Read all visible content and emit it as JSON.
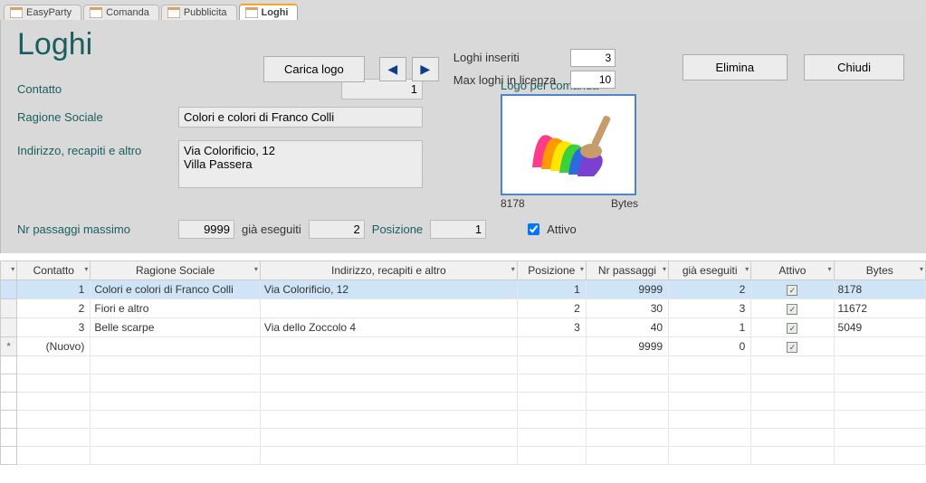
{
  "tabs": [
    {
      "label": "EasyParty"
    },
    {
      "label": "Comanda"
    },
    {
      "label": "Pubblicita"
    },
    {
      "label": "Loghi"
    }
  ],
  "title": "Loghi",
  "btn_load": "Carica logo",
  "btn_delete": "Elimina",
  "btn_close": "Chiudi",
  "lbl_inserted": "Loghi inseriti",
  "lbl_maxlic": "Max loghi in licenza",
  "val_inserted": "3",
  "val_maxlic": "10",
  "lbl_contatto": "Contatto",
  "lbl_ragione": "Ragione Sociale",
  "lbl_indirizzo": "Indirizzo, recapiti e altro",
  "lbl_nrpass": "Nr passaggi massimo",
  "lbl_giaeseg": "già eseguiti",
  "lbl_posizione": "Posizione",
  "lbl_attivo": "Attivo",
  "lbl_logoper": "Logo per comanda",
  "val_contatto": "1",
  "val_ragione": "Colori e colori di Franco Colli",
  "val_indirizzo": "Via Colorificio, 12\nVilla Passera",
  "val_nrpass": "9999",
  "val_giaeseg": "2",
  "val_posizione": "1",
  "val_attivo": true,
  "logo_size": "8178",
  "logo_bytes_lbl": "Bytes",
  "cols": {
    "contatto": "Contatto",
    "ragione": "Ragione Sociale",
    "indirizzo": "Indirizzo, recapiti e altro",
    "posizione": "Posizione",
    "passaggi": "Nr passaggi",
    "eseguiti": "già eseguiti",
    "attivo": "Attivo",
    "bytes": "Bytes"
  },
  "rows": [
    {
      "contatto": "1",
      "ragione": "Colori e colori di Franco Colli",
      "indirizzo": "Via Colorificio, 12",
      "pos": "1",
      "pass": "9999",
      "esec": "2",
      "attivo": true,
      "bytes": "8178",
      "selected": true
    },
    {
      "contatto": "2",
      "ragione": "Fiori e altro",
      "indirizzo": "",
      "pos": "2",
      "pass": "30",
      "esec": "3",
      "attivo": true,
      "bytes": "11672"
    },
    {
      "contatto": "3",
      "ragione": "Belle scarpe",
      "indirizzo": "Via dello Zoccolo 4",
      "pos": "3",
      "pass": "40",
      "esec": "1",
      "attivo": true,
      "bytes": "5049"
    }
  ],
  "newrow_label": "(Nuovo)",
  "newrow_pass": "9999",
  "newrow_esec": "0"
}
